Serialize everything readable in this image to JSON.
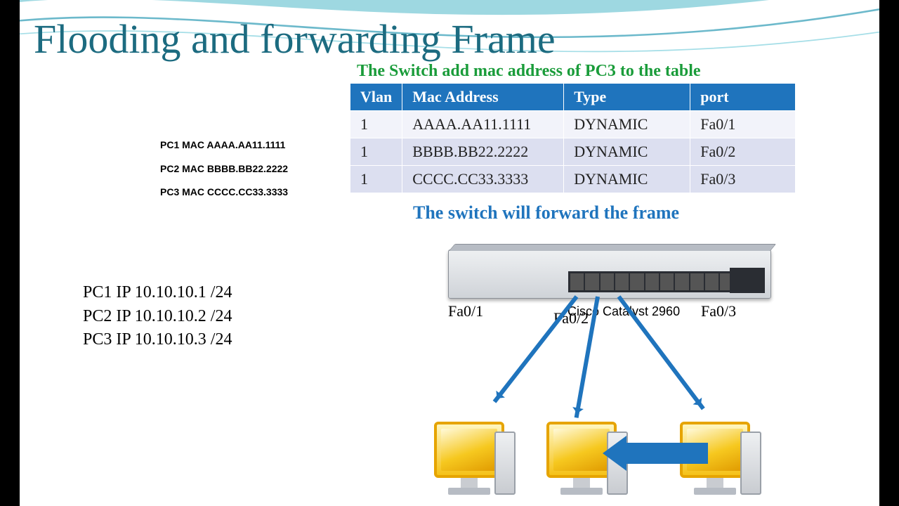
{
  "title": "Flooding and forwarding Frame",
  "caption1": "The Switch add mac address of PC3 to the table",
  "caption2": "The switch will forward the frame",
  "table": {
    "headers": {
      "vlan": "Vlan",
      "mac": "Mac Address",
      "type": "Type",
      "port": "port"
    },
    "rows": [
      {
        "vlan": "1",
        "mac": "AAAA.AA11.1111",
        "type": "DYNAMIC",
        "port": "Fa0/1"
      },
      {
        "vlan": "1",
        "mac": "BBBB.BB22.2222",
        "type": "DYNAMIC",
        "port": "Fa0/2"
      },
      {
        "vlan": "1",
        "mac": "CCCC.CC33.3333",
        "type": "DYNAMIC",
        "port": "Fa0/3"
      }
    ]
  },
  "pcmacs": [
    "PC1 MAC AAAA.AA11.1111",
    "PC2 MAC BBBB.BB22.2222",
    "PC3 MAC CCCC.CC33.3333"
  ],
  "ips": [
    "PC1 IP 10.10.10.1 /24",
    "PC2 IP 10.10.10.2 /24",
    "PC3 IP 10.10.10.3 /24"
  ],
  "switch": {
    "model": "Cisco Catalyst 2960",
    "port_labels": {
      "p1": "Fa0/1",
      "p2": "Fa0/2",
      "p3": "Fa0/3"
    }
  }
}
